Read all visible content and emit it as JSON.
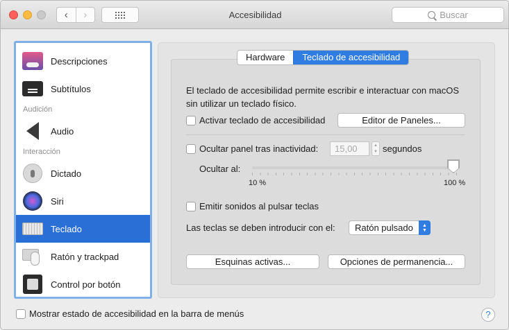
{
  "window": {
    "title": "Accesibilidad",
    "search_placeholder": "Buscar",
    "nav_back": "‹",
    "nav_forward": "›"
  },
  "sidebar": {
    "items": [
      {
        "label": "Descripciones",
        "icon": "descriptions-icon"
      },
      {
        "label": "Subtítulos",
        "icon": "subtitles-icon"
      },
      {
        "label": "Audio",
        "icon": "speaker-icon"
      },
      {
        "label": "Dictado",
        "icon": "microphone-icon"
      },
      {
        "label": "Siri",
        "icon": "siri-icon"
      },
      {
        "label": "Teclado",
        "icon": "keyboard-icon",
        "selected": true
      },
      {
        "label": "Ratón y trackpad",
        "icon": "mouse-trackpad-icon"
      },
      {
        "label": "Control por botón",
        "icon": "switch-control-icon"
      }
    ],
    "headers": {
      "audicion": "Audición",
      "interaccion": "Interacción"
    }
  },
  "tabs": [
    {
      "label": "Hardware",
      "active": false
    },
    {
      "label": "Teclado de accesibilidad",
      "active": true
    }
  ],
  "panel": {
    "description": "El teclado de accesibilidad permite escribir e interactuar con macOS sin utilizar un teclado físico.",
    "enable_keyboard": {
      "label": "Activar teclado de accesibilidad",
      "checked": false
    },
    "panel_editor_button": "Editor de Paneles...",
    "hide_panel": {
      "label": "Ocultar panel tras inactividad:",
      "checked": false
    },
    "hide_value": "15,00",
    "seconds_label": "segundos",
    "hide_at_label": "Ocultar al:",
    "slider": {
      "min_label": "10 %",
      "max_label": "100 %",
      "value": 1.0
    },
    "play_sounds": {
      "label": "Emitir sonidos al pulsar teclas",
      "checked": false
    },
    "input_method_label": "Las teclas se deben introducir con el:",
    "input_method_value": "Ratón pulsado",
    "hot_corners_button": "Esquinas activas...",
    "dwell_options_button": "Opciones de permanencia..."
  },
  "footer": {
    "show_status": {
      "label": "Mostrar estado de accesibilidad en la barra de menús",
      "checked": false
    },
    "help": "?"
  },
  "colors": {
    "accent": "#2f7de1",
    "selection": "#2a6fd6"
  }
}
